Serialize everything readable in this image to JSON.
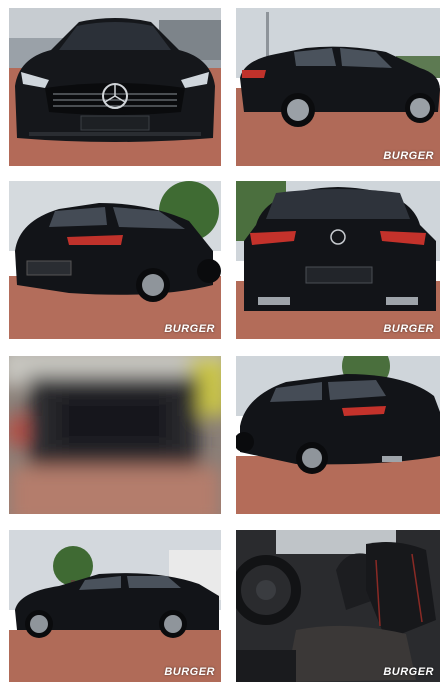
{
  "gallery": {
    "photos": [
      {
        "label": "front-view",
        "watermark": ""
      },
      {
        "label": "rear-quarter-left-view",
        "watermark": "BURGER"
      },
      {
        "label": "rear-quarter-left-view-2",
        "watermark": "BURGER"
      },
      {
        "label": "rear-view",
        "watermark": "BURGER"
      },
      {
        "label": "blurred-photo",
        "watermark": ""
      },
      {
        "label": "rear-quarter-left-view-3",
        "watermark": ""
      },
      {
        "label": "side-view",
        "watermark": "BURGER"
      },
      {
        "label": "interior-driver-seat",
        "watermark": "BURGER"
      }
    ]
  },
  "colors": {
    "car_body": "#121418",
    "pavement": "#b06a58",
    "sky": "#cfd5da",
    "brand_watermark": "#ffffff"
  }
}
